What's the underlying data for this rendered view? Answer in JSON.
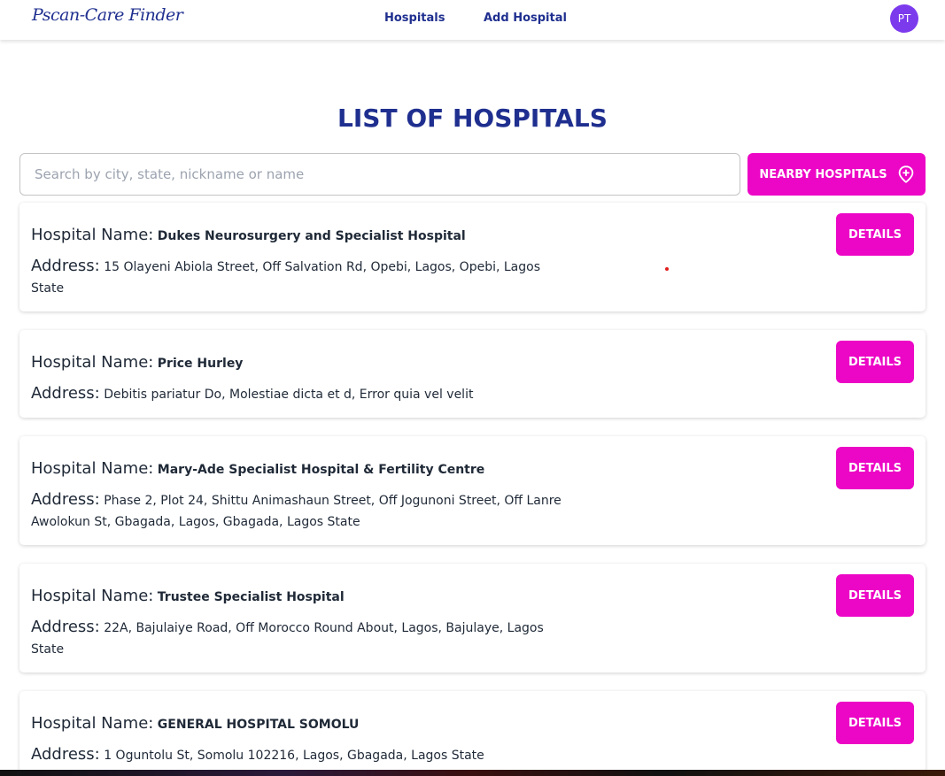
{
  "navbar": {
    "brand": "Pscan-Care Finder",
    "links": [
      "Hospitals",
      "Add Hospital"
    ],
    "avatar_initials": "PT"
  },
  "page_title": "LIST OF HOSPITALS",
  "search": {
    "placeholder": "Search by city, state, nickname or name",
    "value": ""
  },
  "nearby_button": {
    "label": "NEARBY HOSPITALS",
    "icon": "map-pin-plus-icon"
  },
  "hospital_name_label": "Hospital Name:",
  "address_label": "Address:",
  "details_label": "DETAILS",
  "hospitals": [
    {
      "name": "Dukes Neurosurgery and Specialist Hospital",
      "address": "15 Olayeni Abiola Street, Off Salvation Rd, Opebi, Lagos, Opebi, Lagos State"
    },
    {
      "name": "Price Hurley",
      "address": "Debitis pariatur Do, Molestiae dicta et d, Error quia vel velit"
    },
    {
      "name": "Mary-Ade Specialist Hospital & Fertility Centre",
      "address": "Phase 2, Plot 24, Shittu Animashaun Street, Off Jogunoni Street, Off Lanre Awolokun St, Gbagada, Lagos, Gbagada, Lagos State"
    },
    {
      "name": "Trustee Specialist Hospital",
      "address": "22A, Bajulaiye Road, Off Morocco Round About, Lagos, Bajulaye, Lagos State"
    },
    {
      "name": "GENERAL HOSPITAL SOMOLU",
      "address": "1 Oguntolu St, Somolu 102216, Lagos, Gbagada, Lagos State"
    }
  ],
  "colors": {
    "brand_blue": "#1f2f8f",
    "accent_magenta": "#ec06c6",
    "avatar_purple": "#7c3aed"
  }
}
